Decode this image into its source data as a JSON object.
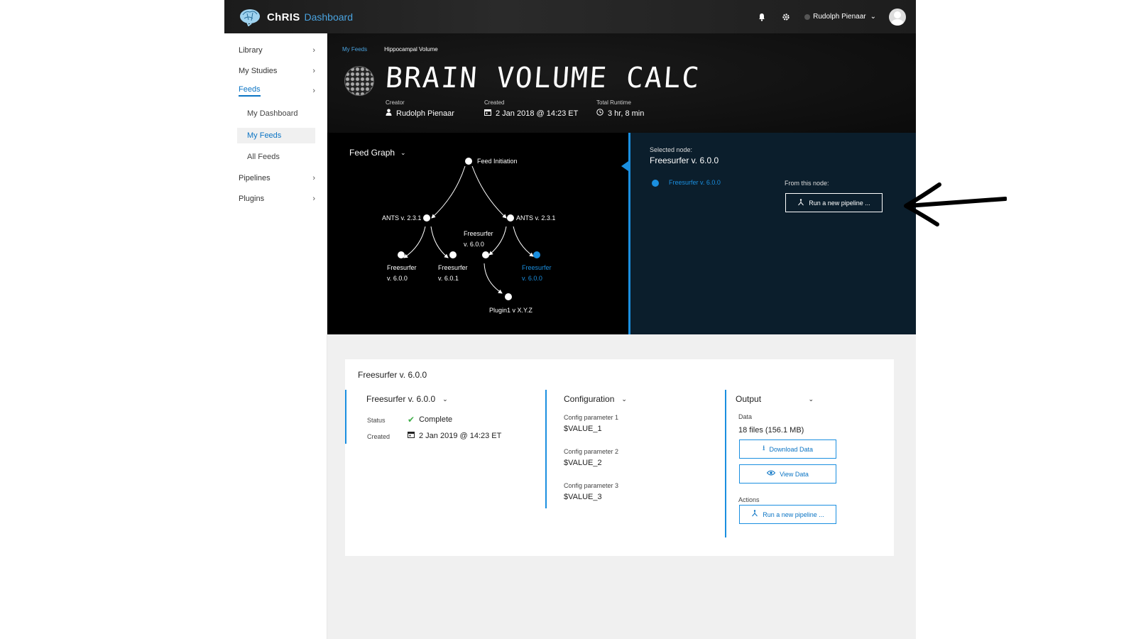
{
  "header": {
    "brand_name": "ChRIS",
    "brand_sub": "Dashboard",
    "user_name": "Rudolph Pienaar",
    "icons": [
      "bell-icon",
      "gear-icon",
      "chevron-down-icon",
      "avatar-icon"
    ]
  },
  "sidebar": {
    "items": [
      {
        "label": "Library"
      },
      {
        "label": "My Studies"
      },
      {
        "label": "Feeds"
      },
      {
        "label": "Pipelines"
      },
      {
        "label": "Plugins"
      }
    ],
    "feeds_sub": [
      {
        "label": "My Dashboard"
      },
      {
        "label": "My Feeds"
      },
      {
        "label": "All Feeds"
      }
    ]
  },
  "feed": {
    "breadcrumb_parent": "My Feeds",
    "breadcrumb_current": "Hippocampal Volume",
    "title": "BRAIN VOLUME CALC",
    "creator_label": "Creator",
    "creator_value": "Rudolph Pienaar",
    "created_label": "Created",
    "created_value": "2 Jan 2018 @ 14:23 ET",
    "runtime_label": "Total Runtime",
    "runtime_value": "3 hr, 8 min"
  },
  "graph": {
    "title": "Feed Graph",
    "nodes": {
      "root": "Feed Initiation",
      "ants_left": "ANTS v. 2.3.1",
      "ants_right": "ANTS v. 2.3.1",
      "fs_mid_line1": "Freesurfer",
      "fs_mid_line2": "v. 6.0.0",
      "fs1_line1": "Freesurfer",
      "fs1_line2": "v. 6.0.0",
      "fs2_line1": "Freesurfer",
      "fs2_line2": "v. 6.0.1",
      "fs_sel_line1": "Freesurfer",
      "fs_sel_line2": "v. 6.0.0",
      "plugin": "Plugin1 v X.Y.Z"
    },
    "selected_color": "#1a8fe0"
  },
  "selected_node": {
    "label": "Selected node:",
    "name": "Freesurfer v. 6.0.0",
    "node_name": "Freesurfer v. 6.0.0",
    "from_label": "From this node:",
    "run_label": "Run a new pipeline ..."
  },
  "detail": {
    "card_title": "Freesurfer v. 6.0.0",
    "plugin_col": {
      "head": "Freesurfer v. 6.0.0",
      "status_label": "Status",
      "status_value": "Complete",
      "created_label": "Created",
      "created_value": "2 Jan 2019 @ 14:23 ET"
    },
    "config_col": {
      "head": "Configuration",
      "params": [
        {
          "label": "Config parameter 1",
          "value": "$VALUE_1"
        },
        {
          "label": "Config parameter 2",
          "value": "$VALUE_2"
        },
        {
          "label": "Config parameter 3",
          "value": "$VALUE_3"
        }
      ]
    },
    "output_col": {
      "head": "Output",
      "data_label": "Data",
      "data_value": "18 files (156.1 MB)",
      "download_label": "Download Data",
      "view_label": "View Data",
      "actions_label": "Actions",
      "run_label": "Run a new pipeline ..."
    }
  },
  "colors": {
    "accent": "#1a8fe0",
    "link": "#0b74c4",
    "success": "#3fae49"
  }
}
